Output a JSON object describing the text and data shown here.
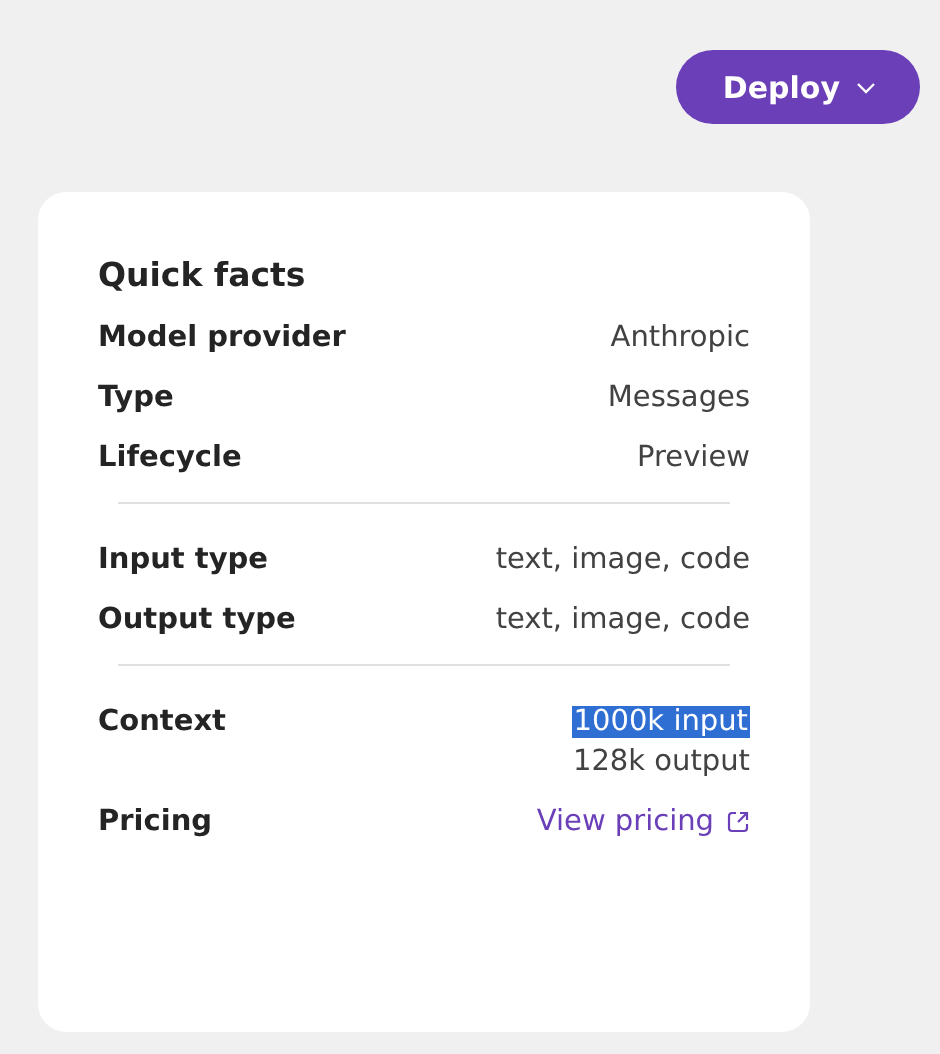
{
  "deploy_button": {
    "label": "Deploy"
  },
  "card": {
    "title": "Quick facts",
    "sections": [
      {
        "rows": [
          {
            "label": "Model provider",
            "kind": "text",
            "values": [
              {
                "text": "Anthropic",
                "selected": false
              }
            ]
          },
          {
            "label": "Type",
            "kind": "text",
            "values": [
              {
                "text": "Messages",
                "selected": false
              }
            ]
          },
          {
            "label": "Lifecycle",
            "kind": "text",
            "values": [
              {
                "text": "Preview",
                "selected": false
              }
            ]
          }
        ]
      },
      {
        "rows": [
          {
            "label": "Input type",
            "kind": "text",
            "values": [
              {
                "text": "text, image, code",
                "selected": false
              }
            ]
          },
          {
            "label": "Output type",
            "kind": "text",
            "values": [
              {
                "text": "text, image, code",
                "selected": false
              }
            ]
          }
        ]
      },
      {
        "rows": [
          {
            "label": "Context",
            "kind": "text",
            "values": [
              {
                "text": "1000k input",
                "selected": true
              },
              {
                "text": "128k output",
                "selected": false
              }
            ]
          },
          {
            "label": "Pricing",
            "kind": "link",
            "values": [
              {
                "text": "View pricing",
                "selected": false
              }
            ]
          }
        ]
      }
    ]
  }
}
